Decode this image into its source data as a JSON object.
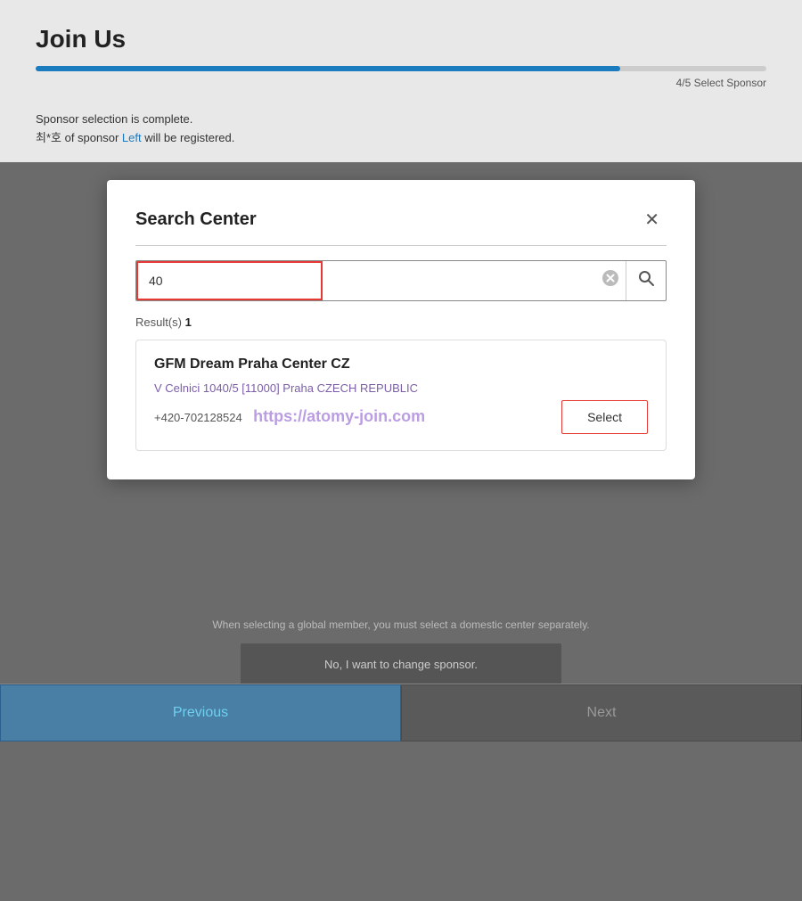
{
  "page": {
    "title": "Join Us",
    "progress": {
      "percent": 80,
      "label": "4/5 Select Sponsor"
    },
    "sponsor_info": {
      "line1": "Sponsor selection is complete.",
      "line2_prefix": "최*호 of sponsor ",
      "line2_link": "Left",
      "line2_suffix": " will be registered."
    }
  },
  "modal": {
    "title": "Search Center",
    "close_icon": "✕",
    "search": {
      "value": "40",
      "placeholder": ""
    },
    "results_label": "Result(s)",
    "results_count": "1",
    "result": {
      "name": "GFM Dream Praha Center CZ",
      "address": "V Celnici 1040/5 [11000] Praha CZECH REPUBLIC",
      "phone": "+420-702128524",
      "watermark": "https://atomy-join.com",
      "select_label": "Select"
    }
  },
  "below_modal": {
    "notice": "When selecting a global member, you must select a domestic center separately.",
    "change_sponsor_label": "No, I want to change sponsor."
  },
  "footer": {
    "previous_label": "Previous",
    "next_label": "Next"
  }
}
